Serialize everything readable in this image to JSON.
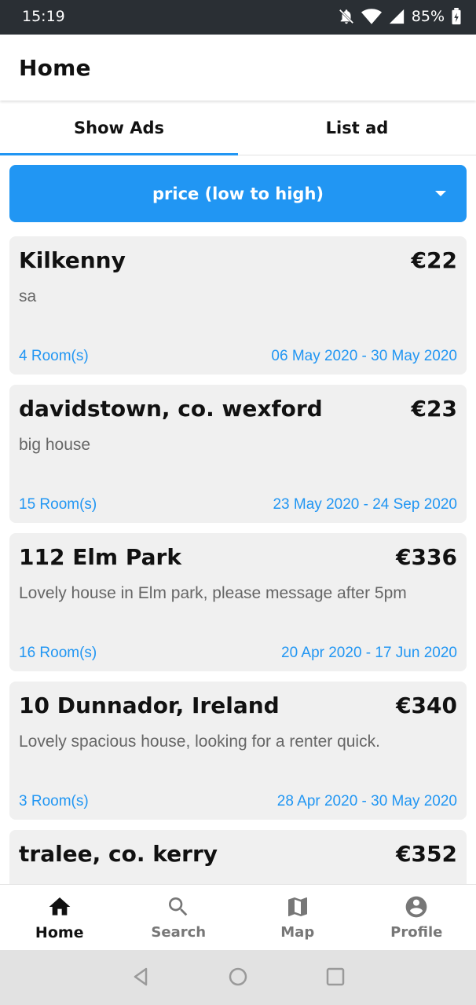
{
  "status_bar": {
    "time": "15:19",
    "battery": "85%",
    "icons": [
      "notifications-off-icon",
      "wifi-icon",
      "signal-icon",
      "battery-icon"
    ]
  },
  "app_bar": {
    "title": "Home"
  },
  "tabs": [
    {
      "label": "Show Ads",
      "active": true
    },
    {
      "label": "List ad",
      "active": false
    }
  ],
  "sort": {
    "selected": "price (low to high)"
  },
  "listings": [
    {
      "title": "Kilkenny",
      "price": "€22",
      "description": "sa",
      "rooms": "4 Room(s)",
      "dates": "06 May 2020 - 30 May 2020"
    },
    {
      "title": "davidstown, co. wexford",
      "price": "€23",
      "description": "big house",
      "rooms": "15 Room(s)",
      "dates": "23 May 2020 - 24 Sep 2020"
    },
    {
      "title": "112 Elm Park",
      "price": "€336",
      "description": "Lovely house in Elm park, please message after 5pm",
      "rooms": "16 Room(s)",
      "dates": "20 Apr 2020 - 17 Jun 2020"
    },
    {
      "title": "10 Dunnador, Ireland",
      "price": "€340",
      "description": "Lovely spacious house, looking for a renter quick.",
      "rooms": "3 Room(s)",
      "dates": "28 Apr 2020 - 30 May 2020"
    },
    {
      "title": "tralee, co. kerry",
      "price": "€352"
    }
  ],
  "bottom_nav": [
    {
      "label": "Home",
      "icon": "home-icon",
      "active": true
    },
    {
      "label": "Search",
      "icon": "search-icon",
      "active": false
    },
    {
      "label": "Map",
      "icon": "map-icon",
      "active": false
    },
    {
      "label": "Profile",
      "icon": "account-circle-icon",
      "active": false
    }
  ],
  "colors": {
    "accent": "#2196f3",
    "status_bar": "#2a2f34",
    "card_bg": "#f0f0f0",
    "secondary_text": "#666666"
  }
}
